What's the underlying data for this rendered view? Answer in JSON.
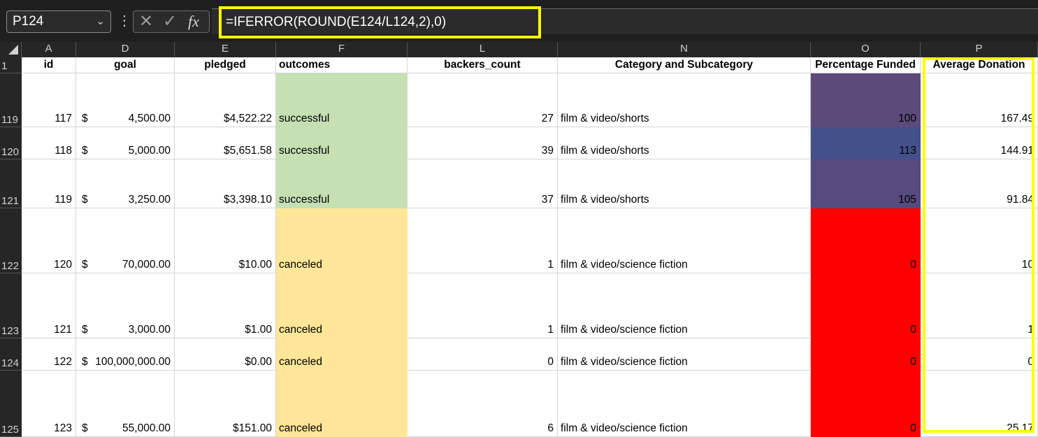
{
  "name_box": {
    "value": "P124"
  },
  "formula_bar": {
    "formula": "=IFERROR(ROUND(E124/L124,2),0)",
    "cancel_glyph": "✕",
    "enter_glyph": "✓",
    "fx_label": "fx"
  },
  "columns": [
    "A",
    "D",
    "E",
    "F",
    "L",
    "N",
    "O",
    "P"
  ],
  "headers": {
    "id": "id",
    "goal": "goal",
    "pledged": "pledged",
    "outcomes": "outcomes",
    "backers_count": "backers_count",
    "category": "Category and Subcategory",
    "pct": "Percentage Funded",
    "avg": "Average Donation"
  },
  "rows": [
    {
      "row": "119",
      "id": "117",
      "goal": "4,500.00",
      "pledged": "$4,522.22",
      "outcome": "successful",
      "backers": "27",
      "category": "film & video/shorts",
      "pct": "100",
      "avg": "167.49",
      "pct_color": "#5b4a7a",
      "outcome_color": "#c6e0b4"
    },
    {
      "row": "120",
      "id": "118",
      "goal": "5,000.00",
      "pledged": "$5,651.58",
      "outcome": "successful",
      "backers": "39",
      "category": "film & video/shorts",
      "pct": "113",
      "avg": "144.91",
      "pct_color": "#43508a",
      "outcome_color": "#c6e0b4"
    },
    {
      "row": "121",
      "id": "119",
      "goal": "3,250.00",
      "pledged": "$3,398.10",
      "outcome": "successful",
      "backers": "37",
      "category": "film & video/shorts",
      "pct": "105",
      "avg": "91.84",
      "pct_color": "#554b7e",
      "outcome_color": "#c6e0b4"
    },
    {
      "row": "122",
      "id": "120",
      "goal": "70,000.00",
      "pledged": "$10.00",
      "outcome": "canceled",
      "backers": "1",
      "category": "film & video/science fiction",
      "pct": "0",
      "avg": "10",
      "pct_color": "#ff0000",
      "outcome_color": "#ffe699"
    },
    {
      "row": "123",
      "id": "121",
      "goal": "3,000.00",
      "pledged": "$1.00",
      "outcome": "canceled",
      "backers": "1",
      "category": "film & video/science fiction",
      "pct": "0",
      "avg": "1",
      "pct_color": "#ff0000",
      "outcome_color": "#ffe699"
    },
    {
      "row": "124",
      "id": "122",
      "goal": "100,000,000.00",
      "pledged": "$0.00",
      "outcome": "canceled",
      "backers": "0",
      "category": "film & video/science fiction",
      "pct": "0",
      "avg": "0",
      "pct_color": "#ff0000",
      "outcome_color": "#ffe699"
    },
    {
      "row": "125",
      "id": "123",
      "goal": "55,000.00",
      "pledged": "$151.00",
      "outcome": "canceled",
      "backers": "6",
      "category": "film & video/science fiction",
      "pct": "0",
      "avg": "25.17",
      "pct_color": "#ff0000",
      "outcome_color": "#ffe699"
    }
  ],
  "currency_symbol": "$",
  "header_row_label": "1",
  "colors": {
    "highlight": "#ffff00",
    "successful": "#c6e0b4",
    "canceled": "#ffe699"
  }
}
